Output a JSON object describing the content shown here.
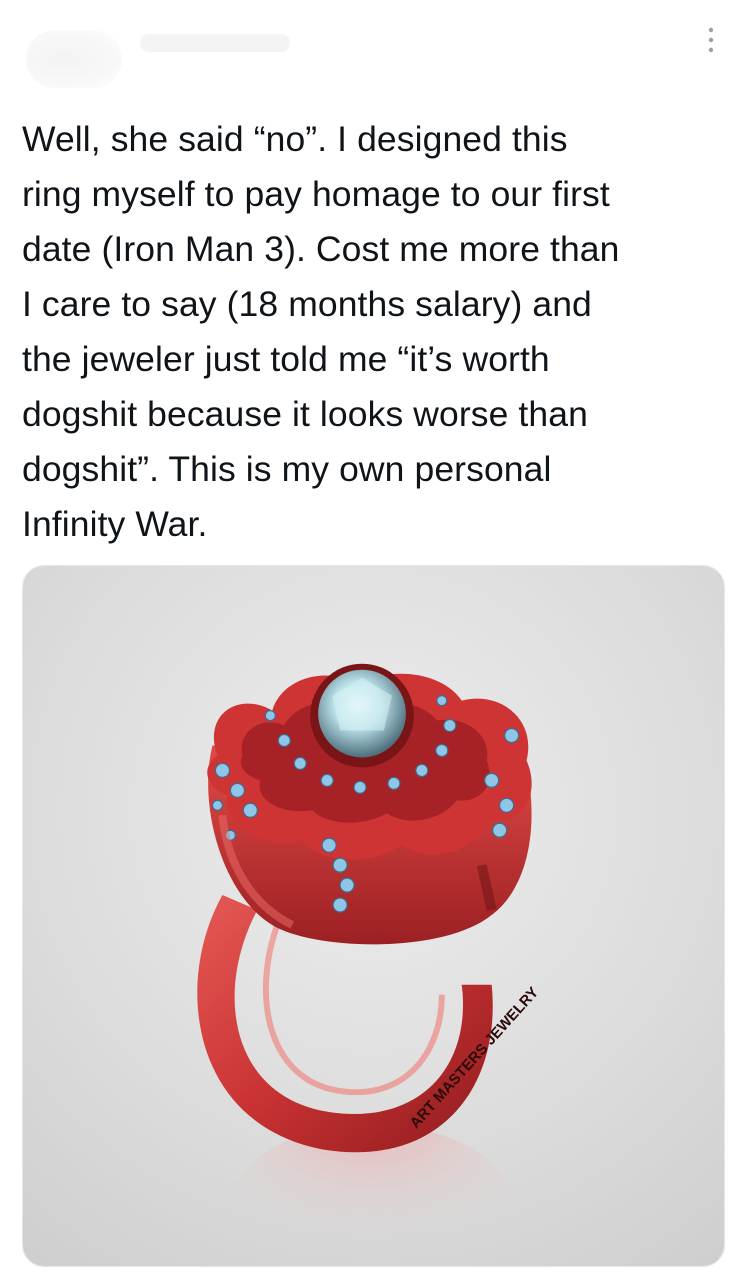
{
  "tweet": {
    "text": "Well, she said “no”. I designed this ring myself to pay homage to our first date (Iron Man 3). Cost me more than I care to say (18 months salary) and the jeweler just told me “it’s worth dogshit because it looks worse than dogshit”. This is my own personal Infinity War.",
    "lines": [
      "Well, she said “no”. I designed this",
      "ring myself to pay homage to our first",
      "date (Iron Man 3). Cost me more than",
      "I care to say (18 months salary) and",
      "the jeweler just told me “it’s worth",
      "dogshit because it looks worse than",
      "dogshit”. This is my own personal",
      "Infinity War."
    ],
    "more_icon": "more-vertical-icon"
  },
  "media": {
    "engraving": "ART MASTERS JEWELRY",
    "colors": {
      "ring": "#d63a3a",
      "ring_dark": "#9e1f22",
      "stones": "#8fc6e8",
      "center_stone": "#bfe3ea",
      "background": "#d9d9d9"
    }
  }
}
